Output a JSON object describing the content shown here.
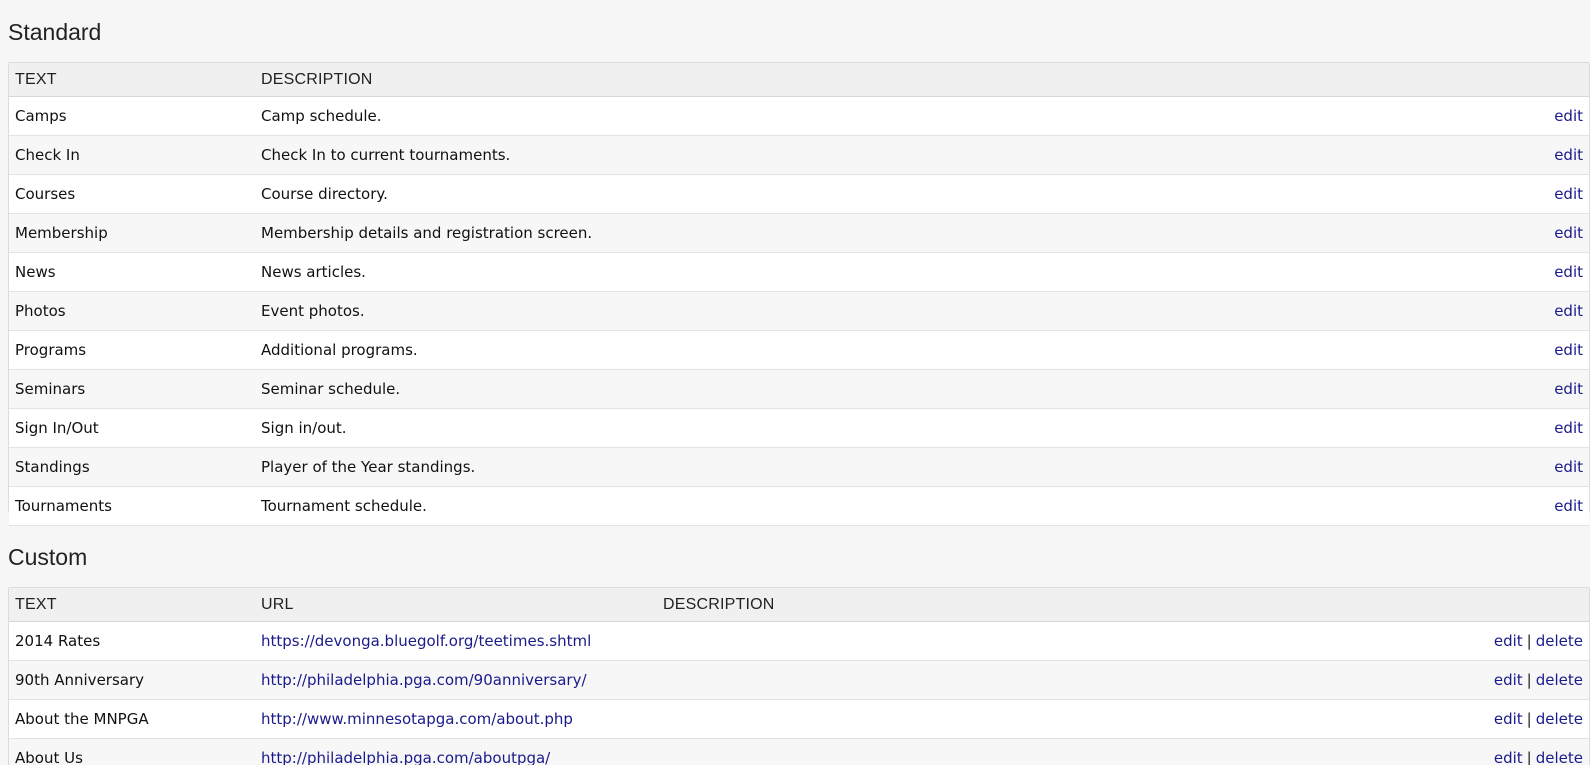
{
  "standard": {
    "title": "Standard",
    "headers": {
      "text": "TEXT",
      "description": "DESCRIPTION"
    },
    "edit_label": "edit",
    "rows": [
      {
        "text": "Camps",
        "description": "Camp schedule."
      },
      {
        "text": "Check In",
        "description": "Check In to current tournaments."
      },
      {
        "text": "Courses",
        "description": "Course directory."
      },
      {
        "text": "Membership",
        "description": "Membership details and registration screen."
      },
      {
        "text": "News",
        "description": "News articles."
      },
      {
        "text": "Photos",
        "description": "Event photos."
      },
      {
        "text": "Programs",
        "description": "Additional programs."
      },
      {
        "text": "Seminars",
        "description": "Seminar schedule."
      },
      {
        "text": "Sign In/Out",
        "description": "Sign in/out."
      },
      {
        "text": "Standings",
        "description": "Player of the Year standings."
      },
      {
        "text": "Tournaments",
        "description": "Tournament schedule."
      }
    ]
  },
  "custom": {
    "title": "Custom",
    "headers": {
      "text": "TEXT",
      "url": "URL",
      "description": "DESCRIPTION"
    },
    "edit_label": "edit",
    "delete_label": "delete",
    "separator": "|",
    "rows": [
      {
        "text": "2014 Rates",
        "url": "https://devonga.bluegolf.org/teetimes.shtml",
        "description": ""
      },
      {
        "text": "90th Anniversary",
        "url": "http://philadelphia.pga.com/90anniversary/",
        "description": ""
      },
      {
        "text": "About the MNPGA",
        "url": "http://www.minnesotapga.com/about.php",
        "description": ""
      },
      {
        "text": "About Us",
        "url": "http://philadelphia.pga.com/aboutpga/",
        "description": ""
      }
    ]
  },
  "colors": {
    "link": "#1a1a8c",
    "header_bg": "#f0f0f0",
    "page_bg": "#f6f6f6"
  }
}
